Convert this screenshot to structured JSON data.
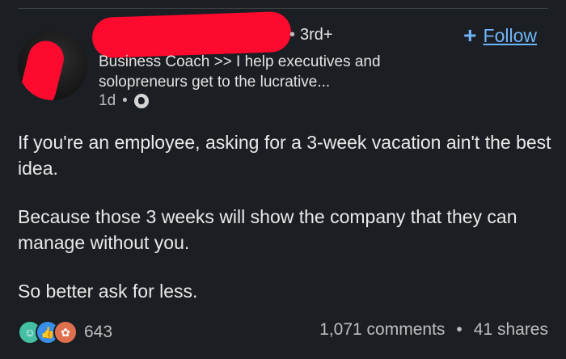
{
  "post": {
    "author": {
      "degree": "3rd+",
      "headline": "Business Coach >> I help executives and solopreneurs get to the lucrative...",
      "time": "1d"
    },
    "follow_label": "Follow",
    "body": [
      "If you're an employee, asking for a 3-week vacation ain't the best idea.",
      "Because those 3 weeks will show the company that they can manage without you.",
      "So better ask for less."
    ],
    "reactions": {
      "icons": [
        "celebrate-icon",
        "like-icon",
        "insightful-icon"
      ],
      "count": "643"
    },
    "comments": "1,071 comments",
    "shares": "41 shares"
  },
  "colors": {
    "background": "#1b1f23",
    "accent": "#70b5f9",
    "redaction": "#ff0a2f"
  }
}
